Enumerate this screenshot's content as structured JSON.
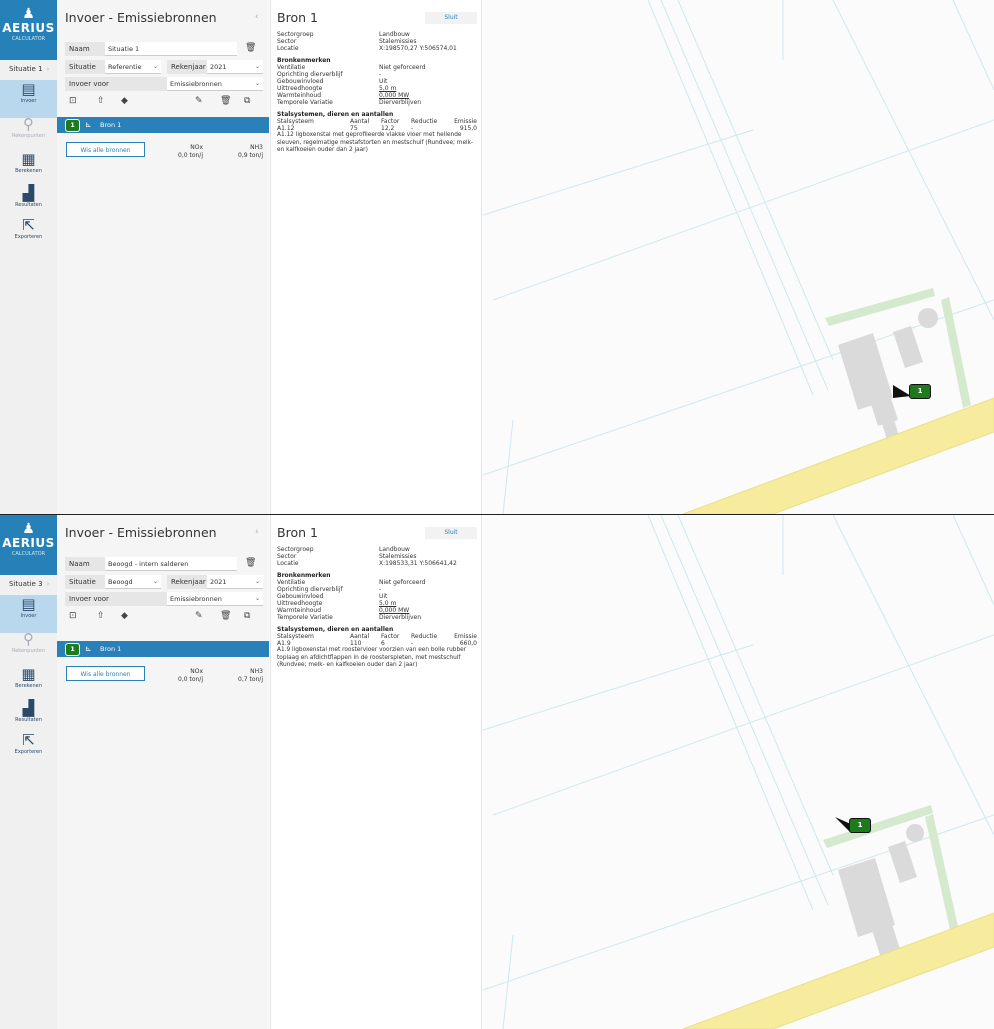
{
  "app": {
    "logo_mark": "♟",
    "logo_name": "AERIUS",
    "logo_sub": "CALCULATOR"
  },
  "nav_items": [
    {
      "label": "Invoer",
      "icon": "clipboard-icon"
    },
    {
      "label": "Rekenpunten",
      "icon": "location-pin-icon"
    },
    {
      "label": "Berekenen",
      "icon": "calculator-icon"
    },
    {
      "label": "Resultaten",
      "icon": "bar-chart-icon"
    },
    {
      "label": "Exporteren",
      "icon": "export-icon"
    }
  ],
  "invoer": {
    "title": "Invoer - Emissiebronnen",
    "naam_label": "Naam",
    "situatie_label": "Situatie",
    "rekenjaar_label": "Rekenjaar",
    "invoer_voor_label": "Invoer voor",
    "invoer_voor_value": "Emissiebronnen",
    "wis_button": "Wis alle bronnen",
    "nox_label": "NOx",
    "nh3_label": "NH3",
    "nox_total": "0,0 ton/j",
    "source_name": "Bron 1",
    "source_number": "1"
  },
  "detail": {
    "title": "Bron 1",
    "close_label": "Sluit",
    "sectorgroep_label": "Sectorgroep",
    "sectorgroep_value": "Landbouw",
    "sector_label": "Sector",
    "sector_value": "Stalemissies",
    "locatie_label": "Locatie",
    "bronkenmerken_header": "Bronkenmerken",
    "ventilatie_label": "Ventilatie",
    "ventilatie_value": "Niet geforceerd",
    "oprichting_label": "Oprichting dierverblijf",
    "oprichting_value": "-",
    "gebouwinvloed_label": "Gebouwinvloed",
    "gebouwinvloed_value": "Uit",
    "uittreedhoogte_label": "Uittreedhoogte",
    "uittreedhoogte_value": "5,0 m",
    "warmteinhoud_label": "Warmteinhoud",
    "warmteinhoud_value": "0,000 MW",
    "temporele_label": "Temporele Variatie",
    "temporele_value": "Dierverblijven",
    "stalsystemen_header": "Stalsystemen, dieren en aantallen",
    "col_stalsysteem": "Stalsysteem",
    "col_aantal": "Aantal",
    "col_factor": "Factor",
    "col_reductie": "Reductie",
    "col_emissie": "Emissie"
  },
  "scenarios": [
    {
      "situatie_nav": "Situatie 1",
      "naam_value": "Situatie 1",
      "situatie_value": "Referentie",
      "rekenjaar_value": "2021",
      "nh3_total": "0,9 ton/j",
      "locatie_value": "X:198570,27 Y:506574,01",
      "stal_code": "A1.12",
      "stal_aantal": "75",
      "stal_factor": "12,2",
      "stal_reductie": "-",
      "stal_emissie": "915,0",
      "stal_description": "A1.12 ligboxenstal met geprofileerde vlakke vloer met hellende sleuven, regelmatige mestafstorten en mestschuif (Rundvee; melk- en kalfkoeien ouder dan 2 jaar)",
      "marker_label": "1"
    },
    {
      "situatie_nav": "Situatie 3",
      "naam_value": "Beoogd - intern salderen",
      "situatie_value": "Beoogd",
      "rekenjaar_value": "2021",
      "nh3_total": "0,7 ton/j",
      "locatie_value": "X:198533,31 Y:506641,42",
      "stal_code": "A1.9",
      "stal_aantal": "110",
      "stal_factor": "6",
      "stal_reductie": "-",
      "stal_emissie": "660,0",
      "stal_description": "A1.9 ligboxenstal met roostervloer voorzien van een bolle rubber toplaag en afdichtflappen in de roosterspleten, met mestschuif (Rundvee; melk- en kalfkoeien ouder dan 2 jaar)",
      "marker_label": "1"
    }
  ],
  "colors": {
    "brand_blue": "#2a80b9",
    "marker_green": "#1d7a1d",
    "road_yellow": "#f7ec9e",
    "building_gray": "#dadada",
    "parcel_green": "#d5e9cf"
  }
}
